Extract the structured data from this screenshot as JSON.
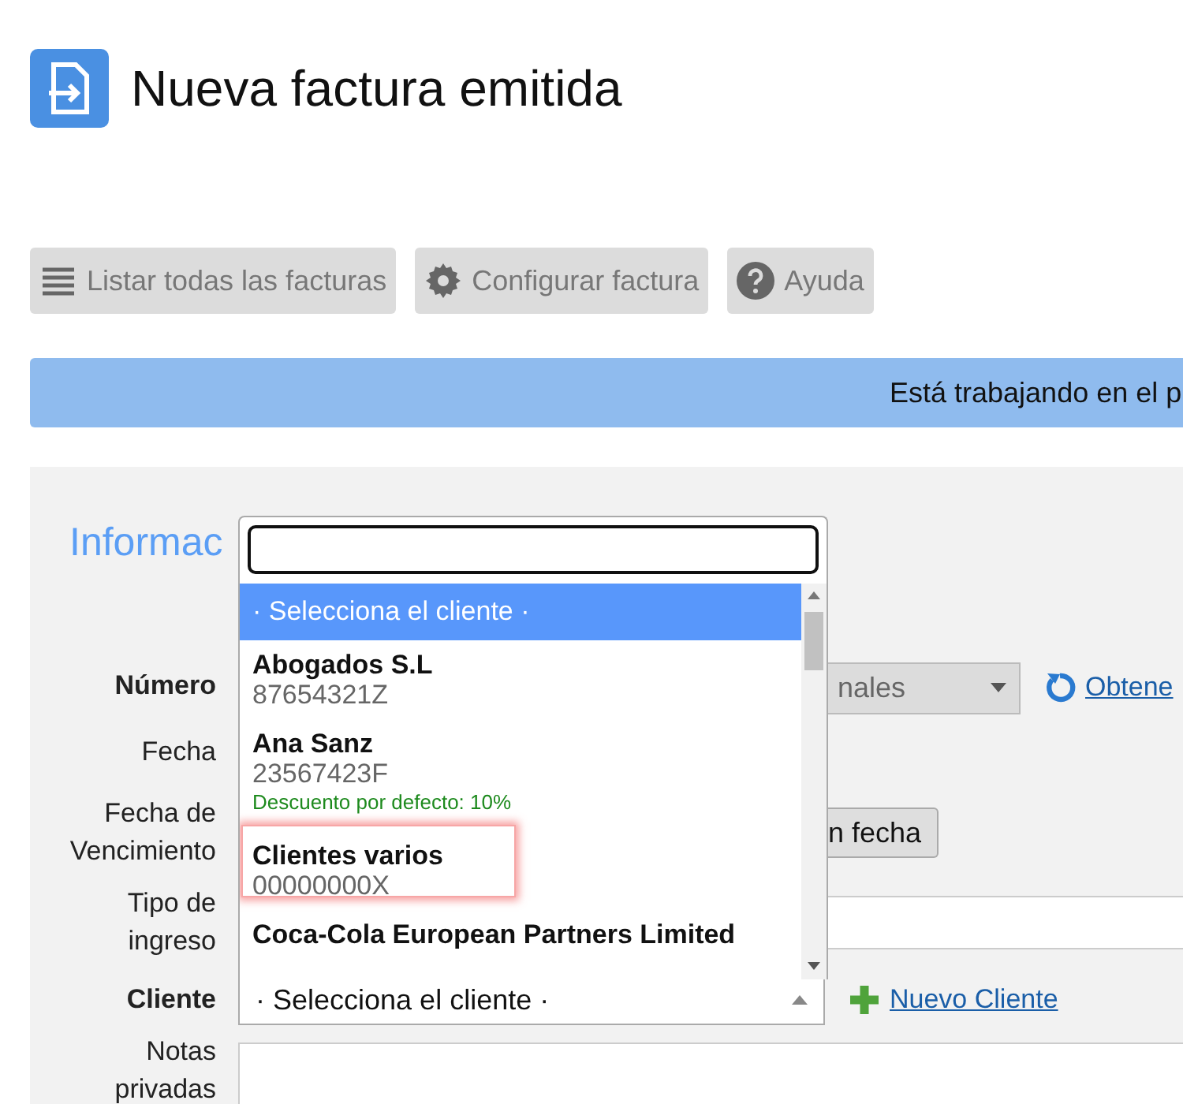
{
  "header": {
    "title": "Nueva factura emitida"
  },
  "toolbar": [
    {
      "label": "Listar todas las facturas"
    },
    {
      "label": "Configurar factura"
    },
    {
      "label": "Ayuda"
    }
  ],
  "banner": {
    "text": "Está trabajando en el p"
  },
  "section": {
    "title": "Informac"
  },
  "form": [
    {
      "label": "Número",
      "bold": true,
      "kind": "select",
      "value": "nales",
      "link": "Obtene"
    },
    {
      "label": "Fecha",
      "bold": false,
      "kind": "empty"
    },
    {
      "label": "Fecha de Vencimiento",
      "bold": false,
      "kind": "button",
      "value": "n fecha"
    },
    {
      "label": "Tipo de ingreso",
      "bold": false,
      "kind": "input"
    },
    {
      "label": "Cliente",
      "bold": true,
      "kind": "client",
      "value": "· Selecciona el cliente ·",
      "link": "Nuevo Cliente"
    },
    {
      "label": "Notas privadas",
      "bold": false,
      "kind": "textarea"
    }
  ],
  "dropdown": {
    "options": [
      {
        "kind": "placeholder",
        "name": "· Selecciona el cliente ·",
        "selected": true,
        "highlighted": false
      },
      {
        "kind": "client",
        "name": "Abogados S.L",
        "code": "87654321Z",
        "selected": false,
        "highlighted": false
      },
      {
        "kind": "client",
        "name": "Ana Sanz",
        "code": "23567423F",
        "note": "Descuento por defecto: 10%",
        "selected": false,
        "highlighted": false
      },
      {
        "kind": "client",
        "name": "Clientes varios",
        "code": "00000000X",
        "selected": false,
        "highlighted": true
      },
      {
        "kind": "client",
        "name": "Coca-Cola European Partners Limited",
        "selected": false,
        "highlighted": false
      }
    ]
  }
}
